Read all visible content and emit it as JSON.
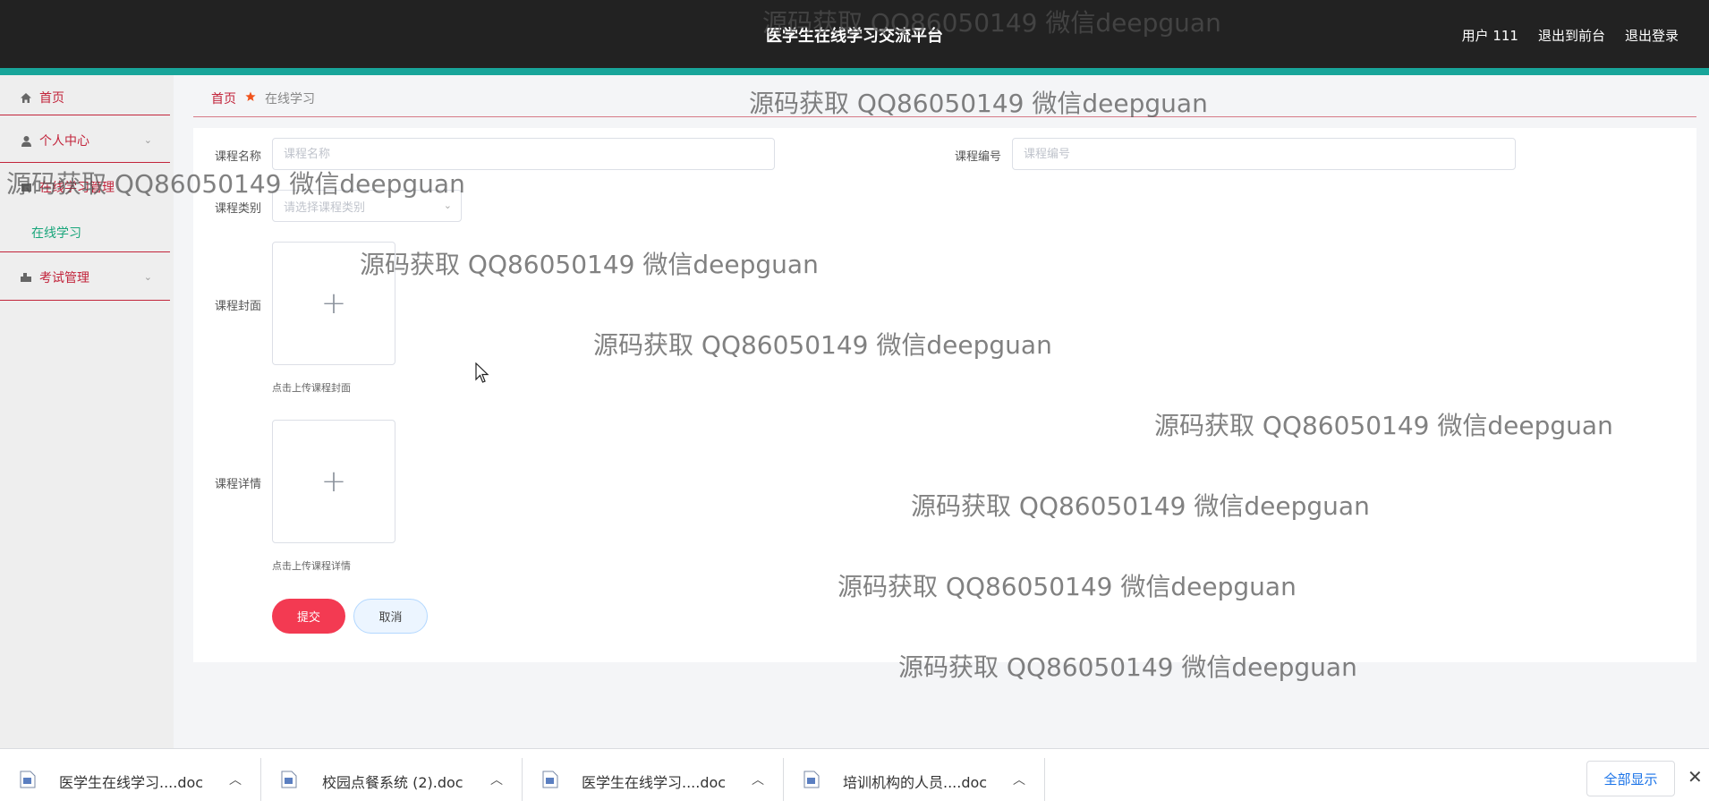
{
  "header": {
    "app_title": "医学生在线学习交流平台",
    "links": [
      "用户 111",
      "退出到前台",
      "退出登录"
    ]
  },
  "sidebar": {
    "home": "首页",
    "personal": "个人中心",
    "course_mgmt": "在线学习管理",
    "course_sub": "在线学习",
    "exam": "考试管理"
  },
  "breadcrumb": {
    "home": "首页",
    "current": "在线学习"
  },
  "form": {
    "course_name_label": "课程名称",
    "course_name_placeholder": "课程名称",
    "course_no_label": "课程编号",
    "course_no_placeholder": "课程编号",
    "category_label": "课程类别",
    "category_placeholder": "请选择课程类别",
    "cover_label": "课程封面",
    "cover_hint": "点击上传课程封面",
    "detail_label": "课程详情",
    "detail_hint": "点击上传课程详情",
    "submit": "提交",
    "cancel": "取消"
  },
  "watermark": "源码获取 QQ86050149 微信deepguan",
  "downloads": {
    "items": [
      "医学生在线学习....doc",
      "校园点餐系统 (2).doc",
      "医学生在线学习....doc",
      "培训机构的人员....doc"
    ],
    "show_all": "全部显示"
  },
  "colors": {
    "accent": "#c2243b",
    "topbar": "#222222",
    "teal": "#18a59a",
    "submit": "#f33a52",
    "sub_active": "#18a57a"
  }
}
